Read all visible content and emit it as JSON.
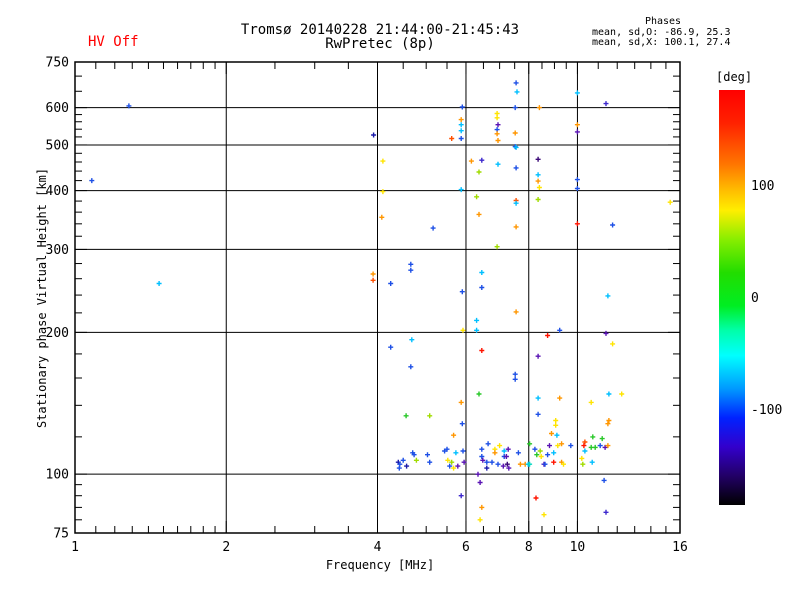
{
  "header": {
    "hv_status": "HV Off",
    "hv_color": "#ff0000",
    "title_line1": "Tromsø 20140228 21:44:00-21:45:43",
    "title_line2": "RwPretec (8p)",
    "phases_heading": "Phases",
    "phases_line_o": "mean, sd,O: -86.9, 25.3",
    "phases_line_x": "mean, sd,X: 100.1, 27.4"
  },
  "chart_data": {
    "type": "scatter",
    "title": "Tromsø 20140228 21:44:00-21:45:43",
    "subtitle": "RwPretec (8p)",
    "grid": "on",
    "x_axis": {
      "label": "Frequency [MHz]",
      "scale": "log",
      "min": 1,
      "max": 16,
      "major_ticks": [
        1,
        2,
        4,
        6,
        8,
        10,
        16
      ],
      "gridlines": [
        2,
        4,
        6,
        8,
        10
      ],
      "minor_ticks": [
        1.1,
        1.2,
        1.3,
        1.4,
        1.5,
        1.6,
        1.7,
        1.8,
        1.9,
        2.5,
        3,
        3.5,
        4.5,
        5,
        5.5,
        6.5,
        7,
        7.5,
        8.5,
        9,
        9.5,
        11,
        12,
        13,
        14,
        15
      ]
    },
    "y_axis": {
      "label": "Stationary phase Virtual Height [km]",
      "scale": "log",
      "min": 75,
      "max": 750,
      "major_ticks": [
        75,
        100,
        200,
        300,
        400,
        500,
        600,
        750
      ],
      "gridlines": [
        100,
        200,
        300,
        400,
        500,
        600
      ],
      "minor_ticks": [
        80,
        85,
        90,
        95,
        120,
        140,
        160,
        180,
        220,
        240,
        260,
        280,
        320,
        340,
        360,
        380,
        420,
        440,
        460,
        480,
        520,
        540,
        560,
        580,
        650,
        700
      ]
    },
    "colorbar": {
      "label": "[deg]",
      "range": [
        -185,
        185
      ],
      "tick_values": [
        100,
        0,
        -100
      ],
      "tick_labels": [
        "100",
        "0",
        "-100"
      ],
      "stops": [
        [
          "#ff0000",
          0
        ],
        [
          "#ff2200",
          8
        ],
        [
          "#ff7700",
          18
        ],
        [
          "#ffbb00",
          24
        ],
        [
          "#ffee00",
          29
        ],
        [
          "#88ee00",
          36
        ],
        [
          "#22dd00",
          44
        ],
        [
          "#00ee22",
          52
        ],
        [
          "#00ffaa",
          58
        ],
        [
          "#00ffff",
          64
        ],
        [
          "#0099ff",
          72
        ],
        [
          "#0022ff",
          79
        ],
        [
          "#3300cc",
          86
        ],
        [
          "#220066",
          93
        ],
        [
          "#000000",
          100
        ]
      ]
    },
    "palette": {
      "b": "#1e50e6",
      "n": "#1a1aaa",
      "v": "#3d28cd",
      "c": "#00bfff",
      "t": "#00d8c0",
      "g": "#28c828",
      "l": "#a0dc00",
      "y": "#ffe400",
      "o": "#ff9600",
      "R": "#ff5000",
      "r": "#ff1400",
      "p": "#5a14b4",
      "d": "#3c0a78"
    },
    "points": [
      [
        1.28,
        605,
        "b"
      ],
      [
        1.08,
        420,
        "b"
      ],
      [
        1.47,
        254,
        "c"
      ],
      [
        3.93,
        525,
        "n"
      ],
      [
        5.9,
        602,
        "b"
      ],
      [
        5.87,
        566,
        "o"
      ],
      [
        5.87,
        552,
        "c"
      ],
      [
        5.87,
        536,
        "c"
      ],
      [
        5.87,
        516,
        "b"
      ],
      [
        5.62,
        516,
        "R"
      ],
      [
        5.87,
        402,
        "c"
      ],
      [
        5.9,
        244,
        "b"
      ],
      [
        5.92,
        202,
        "y"
      ],
      [
        5.87,
        142,
        "o"
      ],
      [
        5.9,
        128,
        "b"
      ],
      [
        5.87,
        90,
        "v"
      ],
      [
        6.92,
        583,
        "y"
      ],
      [
        6.92,
        571,
        "y"
      ],
      [
        6.95,
        552,
        "p"
      ],
      [
        6.92,
        539,
        "b"
      ],
      [
        6.92,
        528,
        "o"
      ],
      [
        6.95,
        511,
        "o"
      ],
      [
        6.95,
        455,
        "c"
      ],
      [
        6.92,
        304,
        "l"
      ],
      [
        7.55,
        677,
        "b"
      ],
      [
        7.58,
        648,
        "c"
      ],
      [
        7.52,
        600,
        "b"
      ],
      [
        7.52,
        530,
        "o"
      ],
      [
        7.52,
        496,
        "b"
      ],
      [
        7.55,
        494,
        "c"
      ],
      [
        7.55,
        447,
        "b"
      ],
      [
        7.55,
        381,
        "R"
      ],
      [
        7.55,
        376,
        "c"
      ],
      [
        7.55,
        335,
        "o"
      ],
      [
        7.55,
        221,
        "o"
      ],
      [
        7.52,
        163,
        "b"
      ],
      [
        7.52,
        159,
        "b"
      ],
      [
        8.4,
        600,
        "o"
      ],
      [
        8.35,
        466,
        "d"
      ],
      [
        8.35,
        432,
        "c"
      ],
      [
        8.35,
        419,
        "o"
      ],
      [
        8.4,
        406,
        "y"
      ],
      [
        8.35,
        383,
        "l"
      ],
      [
        8.35,
        178,
        "p"
      ],
      [
        8.35,
        145,
        "c"
      ],
      [
        8.35,
        134,
        "b"
      ],
      [
        10.0,
        645,
        "c"
      ],
      [
        10.0,
        552,
        "o"
      ],
      [
        10.0,
        533,
        "p"
      ],
      [
        10.0,
        422,
        "b"
      ],
      [
        10.0,
        404,
        "b"
      ],
      [
        10.0,
        340,
        "r"
      ],
      [
        11.4,
        612,
        "v"
      ],
      [
        11.75,
        338,
        "b"
      ],
      [
        11.5,
        239,
        "c"
      ],
      [
        11.4,
        199,
        "p"
      ],
      [
        11.75,
        189,
        "y"
      ],
      [
        11.55,
        148,
        "c"
      ],
      [
        12.25,
        148,
        "y"
      ],
      [
        11.55,
        130,
        "o"
      ],
      [
        15.3,
        378,
        "y"
      ],
      [
        4.1,
        462,
        "y"
      ],
      [
        4.1,
        398,
        "y"
      ],
      [
        4.08,
        351,
        "o"
      ],
      [
        3.92,
        266,
        "o"
      ],
      [
        3.92,
        258,
        "R"
      ],
      [
        4.66,
        279,
        "b"
      ],
      [
        4.66,
        271,
        "b"
      ],
      [
        4.25,
        254,
        "b"
      ],
      [
        4.68,
        193,
        "c"
      ],
      [
        4.25,
        186,
        "b"
      ],
      [
        4.66,
        169,
        "b"
      ],
      [
        6.15,
        462,
        "o"
      ],
      [
        6.45,
        464,
        "v"
      ],
      [
        6.37,
        438,
        "l"
      ],
      [
        6.3,
        388,
        "l"
      ],
      [
        6.37,
        356,
        "o"
      ],
      [
        6.3,
        212,
        "c"
      ],
      [
        6.3,
        202,
        "c"
      ],
      [
        6.45,
        268,
        "c"
      ],
      [
        6.45,
        249,
        "b"
      ],
      [
        6.45,
        183,
        "r"
      ],
      [
        6.37,
        148,
        "g"
      ],
      [
        5.16,
        333,
        "b"
      ],
      [
        8.72,
        197,
        "r"
      ],
      [
        9.22,
        202,
        "b"
      ],
      [
        9.22,
        145,
        "o"
      ],
      [
        10.65,
        142,
        "y"
      ],
      [
        6.4,
        96,
        "p"
      ],
      [
        6.45,
        85,
        "o"
      ],
      [
        6.4,
        80,
        "y"
      ],
      [
        8.58,
        82,
        "y"
      ],
      [
        8.27,
        89,
        "r"
      ],
      [
        11.3,
        97,
        "b"
      ],
      [
        11.4,
        83,
        "v"
      ],
      [
        9.05,
        130,
        "y"
      ],
      [
        9.05,
        127,
        "y"
      ],
      [
        8.88,
        122,
        "o"
      ],
      [
        9.1,
        121,
        "c"
      ],
      [
        11.5,
        128,
        "o"
      ],
      [
        5.67,
        121,
        "o"
      ],
      [
        10.35,
        117,
        "R"
      ],
      [
        10.3,
        115,
        "r"
      ],
      [
        10.73,
        120,
        "g"
      ],
      [
        10.65,
        114,
        "g"
      ],
      [
        10.85,
        114,
        "g"
      ],
      [
        10.35,
        112,
        "c"
      ],
      [
        10.2,
        108,
        "y"
      ],
      [
        10.25,
        105,
        "l"
      ],
      [
        10.7,
        106,
        "c"
      ],
      [
        11.2,
        119,
        "g"
      ],
      [
        11.35,
        114,
        "p"
      ],
      [
        11.1,
        115,
        "b"
      ],
      [
        11.5,
        115,
        "o"
      ],
      [
        4.4,
        106,
        "n"
      ],
      [
        4.43,
        105,
        "b"
      ],
      [
        4.5,
        107,
        "b"
      ],
      [
        4.57,
        104,
        "n"
      ],
      [
        4.42,
        103,
        "b"
      ],
      [
        4.7,
        111,
        "b"
      ],
      [
        4.73,
        110,
        "b"
      ],
      [
        4.78,
        107,
        "l"
      ],
      [
        5.03,
        110,
        "b"
      ],
      [
        5.08,
        106,
        "b"
      ],
      [
        5.44,
        112,
        "b"
      ],
      [
        5.5,
        113,
        "b"
      ],
      [
        5.73,
        111,
        "c"
      ],
      [
        5.92,
        112,
        "b"
      ],
      [
        5.52,
        107,
        "y"
      ],
      [
        5.62,
        106,
        "l"
      ],
      [
        5.95,
        106,
        "p"
      ],
      [
        5.57,
        104,
        "b"
      ],
      [
        5.67,
        103,
        "y"
      ],
      [
        5.78,
        104,
        "p"
      ],
      [
        4.56,
        133,
        "g"
      ],
      [
        5.08,
        133,
        "l"
      ],
      [
        6.45,
        113,
        "b"
      ],
      [
        6.64,
        116,
        "b"
      ],
      [
        6.85,
        113,
        "y"
      ],
      [
        7.0,
        115,
        "y"
      ],
      [
        6.85,
        111,
        "o"
      ],
      [
        7.15,
        112,
        "c"
      ],
      [
        6.45,
        109,
        "b"
      ],
      [
        6.48,
        107,
        "p"
      ],
      [
        6.6,
        106,
        "b"
      ],
      [
        6.76,
        106,
        "b"
      ],
      [
        6.6,
        103,
        "n"
      ],
      [
        6.95,
        105,
        "b"
      ],
      [
        7.12,
        104,
        "p"
      ],
      [
        7.15,
        109,
        "b"
      ],
      [
        7.28,
        113,
        "p"
      ],
      [
        7.3,
        103,
        "p"
      ],
      [
        6.34,
        100,
        "p"
      ],
      [
        8.03,
        116,
        "g"
      ],
      [
        8.8,
        115,
        "p"
      ],
      [
        8.43,
        112,
        "l"
      ],
      [
        9.14,
        115,
        "y"
      ],
      [
        9.3,
        116,
        "o"
      ],
      [
        9.7,
        115,
        "b"
      ],
      [
        8.23,
        113,
        "b"
      ],
      [
        8.3,
        110,
        "g"
      ],
      [
        8.47,
        109,
        "y"
      ],
      [
        8.72,
        110,
        "b"
      ],
      [
        8.97,
        111,
        "c"
      ],
      [
        8.58,
        105,
        "p"
      ],
      [
        7.87,
        105,
        "o"
      ],
      [
        8.97,
        106,
        "r"
      ],
      [
        9.3,
        106,
        "o"
      ],
      [
        9.38,
        105,
        "y"
      ],
      [
        7.98,
        105,
        "c"
      ],
      [
        8.03,
        105,
        "t"
      ],
      [
        7.7,
        105,
        "o"
      ],
      [
        8.62,
        105,
        "b"
      ],
      [
        7.22,
        109,
        "p"
      ],
      [
        7.25,
        105,
        "d"
      ],
      [
        7.63,
        111,
        "b"
      ]
    ]
  }
}
